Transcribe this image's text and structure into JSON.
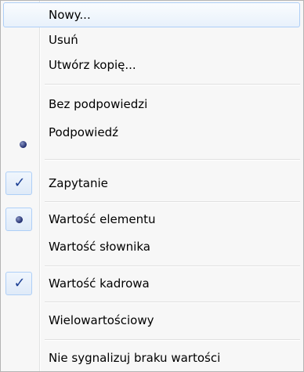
{
  "menu": {
    "items": [
      {
        "label": "Nowy..."
      },
      {
        "label": "Usuń"
      },
      {
        "label": "Utwórz kopię..."
      },
      {
        "label": "Bez podpowiedzi"
      },
      {
        "label": "Podpowiedź"
      },
      {
        "label": "Zapytanie"
      },
      {
        "label": "Wartość elementu"
      },
      {
        "label": "Wartość słownika"
      },
      {
        "label": "Wartość kadrowa"
      },
      {
        "label": "Wielowartościowy"
      },
      {
        "label": "Nie sygnalizuj braku wartości"
      }
    ],
    "marks": {
      "podpowiedz": "radio-bullet-icon",
      "zapytanie": "checkmark-icon",
      "wartosc_elementu": "radio-bullet-icon",
      "wartosc_kadrowa": "checkmark-icon"
    },
    "colors": {
      "hover_border": "#aecff7",
      "check": "#1c3f94",
      "bullet": "#1f2c6e"
    }
  }
}
